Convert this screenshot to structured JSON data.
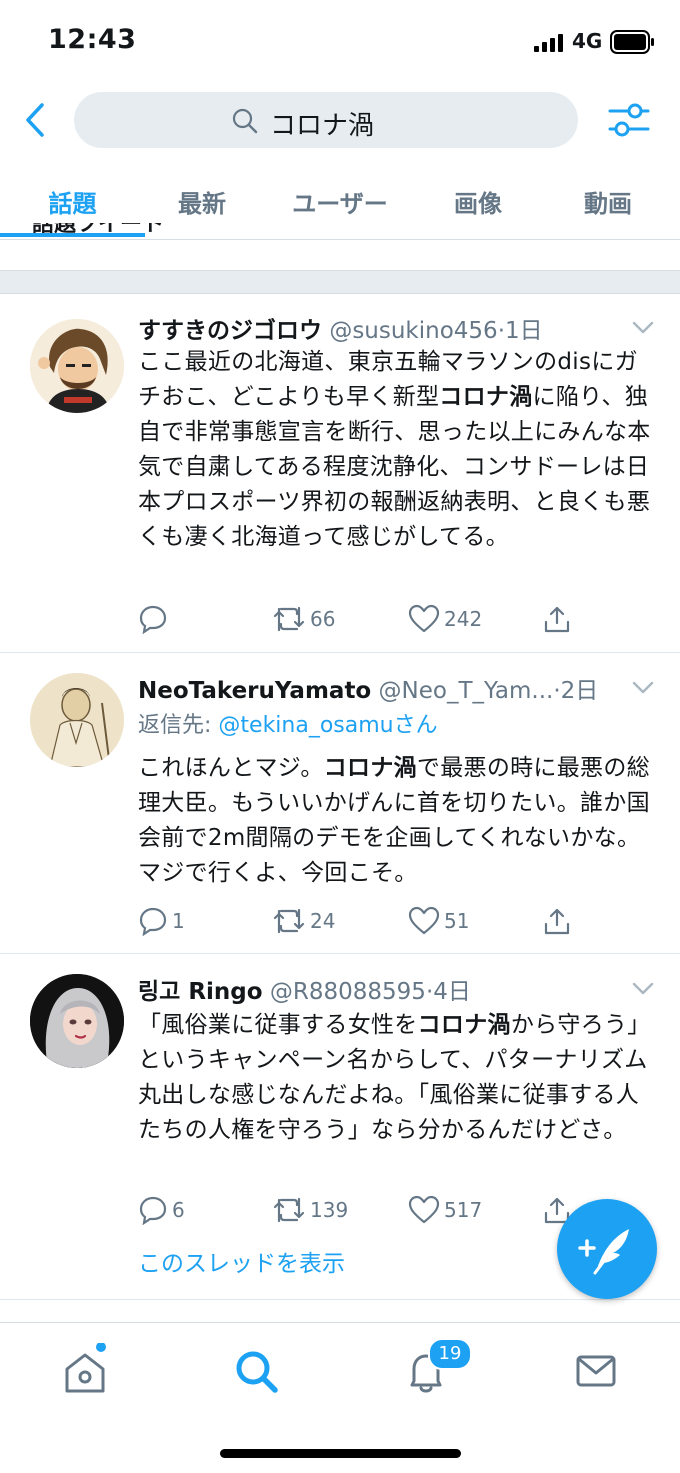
{
  "status_bar": {
    "time": "12:43",
    "network": "4G"
  },
  "search": {
    "query": "コロナ渦"
  },
  "tabs": [
    {
      "label": "話題",
      "active": true
    },
    {
      "label": "最新",
      "active": false
    },
    {
      "label": "ユーザー",
      "active": false
    },
    {
      "label": "画像",
      "active": false
    },
    {
      "label": "動画",
      "active": false
    }
  ],
  "peek_text": "話題ツイート",
  "tweets": [
    {
      "name": "すすきのジゴロウ",
      "handle": "@susukino456",
      "time": "·1日",
      "body_pre": "ここ最近の北海道、東京五輪マラソンのdisにガチおこ、どこよりも早く新型",
      "highlight": "コロナ渦",
      "body_post": "に陥り、独自で非常事態宣言を断行、思った以上にみんな本気で自粛してある程度沈静化、コンサドーレは日本プロスポーツ界初の報酬返納表明、と良くも悪くも凄く北海道って感じがしてる。",
      "replies": "",
      "retweets": "66",
      "likes": "242"
    },
    {
      "name": "NeoTakeruYamato",
      "handle": "@Neo_T_Yam...",
      "time": "·2日",
      "reply_prefix": "返信先: ",
      "reply_handle": "@tekina_osamu",
      "reply_suffix": "さん",
      "body_pre": "これほんとマジ。",
      "highlight": "コロナ渦",
      "body_post": "で最悪の時に最悪の総理大臣。もういいかげんに首を切りたい。誰か国会前で2m間隔のデモを企画してくれないかな。マジで行くよ、今回こそ。",
      "replies": "1",
      "retweets": "24",
      "likes": "51"
    },
    {
      "name": "링고 Ringo",
      "handle": "@R88088595",
      "time": "·4日",
      "body_pre": "「風俗業に従事する女性を",
      "highlight": "コロナ渦",
      "body_post": "から守ろう」というキャンペーン名からして、パターナリズム丸出しな感じなんだよね。「風俗業に従事する人たちの人権を守ろう」なら分かるんだけどさ。",
      "replies": "6",
      "retweets": "139",
      "likes": "517",
      "thread_link": "このスレッドを表示"
    }
  ],
  "notifications_badge": "19",
  "colors": {
    "accent": "#1da1f2",
    "secondary_text": "#657786",
    "divider": "#e1e8ed"
  }
}
